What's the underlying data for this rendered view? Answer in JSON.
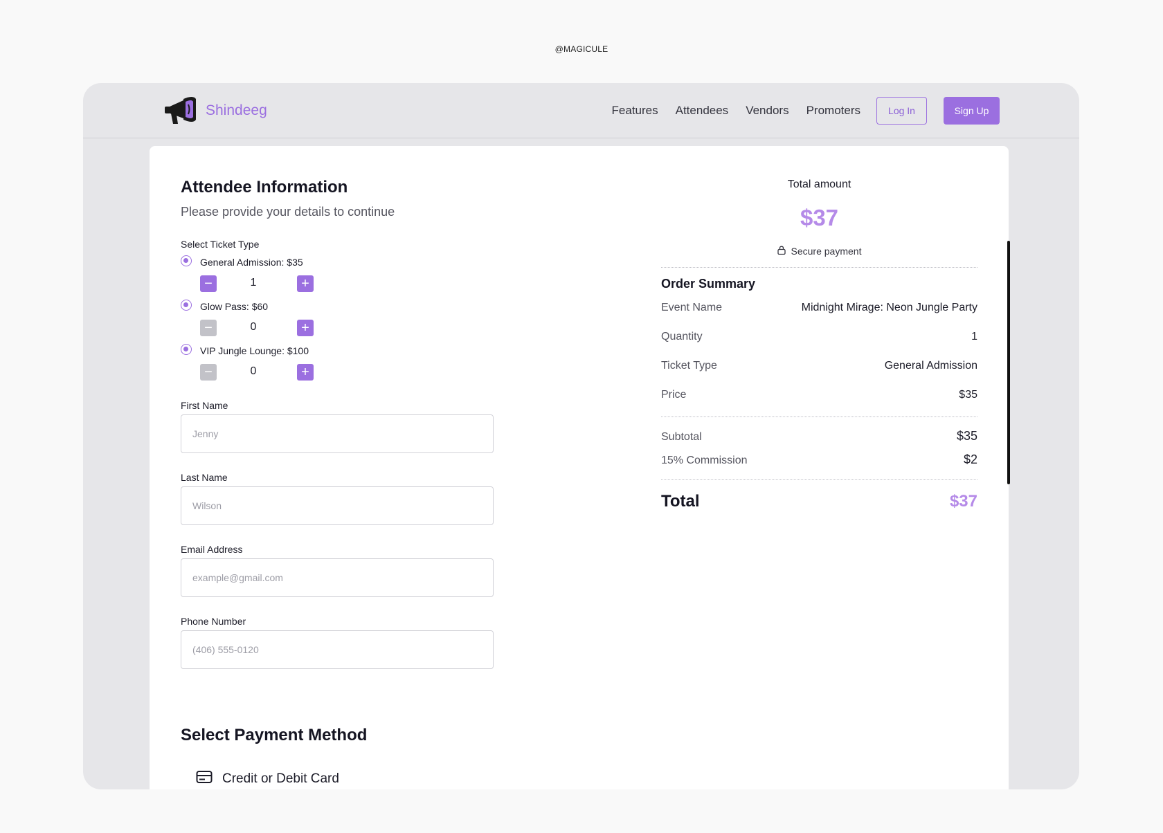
{
  "watermark": "@MAGICULE",
  "nav": {
    "brand": "Shindeeg",
    "brand_icon": "megaphone-icon",
    "links": [
      "Features",
      "Attendees",
      "Vendors",
      "Promoters"
    ],
    "login": "Log In",
    "signup": "Sign Up",
    "accent_color": "#9b6fe0"
  },
  "form": {
    "title": "Attendee Information",
    "subtitle": "Please provide your details to continue",
    "ticket_label": "Select Ticket Type",
    "tickets": [
      {
        "label": "General Admission: $35",
        "quantity": "1",
        "minus_enabled": true
      },
      {
        "label": "Glow Pass: $60",
        "quantity": "0",
        "minus_enabled": false
      },
      {
        "label": "VIP Jungle Lounge: $100",
        "quantity": "0",
        "minus_enabled": false
      }
    ],
    "fields": [
      {
        "label": "First Name",
        "placeholder": "Jenny"
      },
      {
        "label": "Last Name",
        "placeholder": "Wilson"
      },
      {
        "label": "Email Address",
        "placeholder": "example@gmail.com"
      },
      {
        "label": "Phone Number",
        "placeholder": "(406) 555-0120"
      }
    ],
    "payment_title": "Select Payment Method",
    "payment_option": "Credit or Debit Card",
    "payment_icon": "credit-card-icon"
  },
  "summary": {
    "total_label": "Total amount",
    "total_amount": "$37",
    "secure_label": "Secure payment",
    "secure_icon": "lock-icon",
    "order_title": "Order Summary",
    "rows": [
      {
        "key": "Event Name",
        "value": "Midnight Mirage: Neon Jungle Party"
      },
      {
        "key": "Quantity",
        "value": "1"
      },
      {
        "key": "Ticket Type",
        "value": "General Admission"
      },
      {
        "key": "Price",
        "value": "$35"
      }
    ],
    "subtotal_label": "Subtotal",
    "subtotal_value": "$35",
    "commission_label": "15% Commission",
    "commission_value": "$2",
    "grand_label": "Total",
    "grand_value": "$37",
    "total_color": "#b58ae8"
  }
}
